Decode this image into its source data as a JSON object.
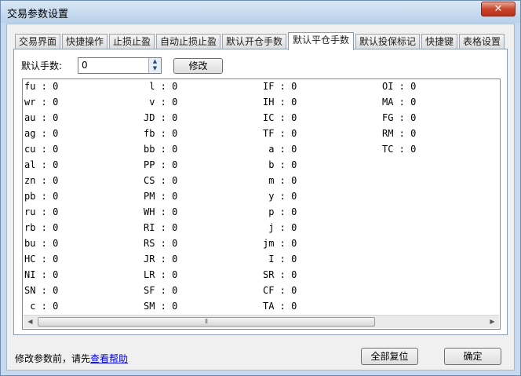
{
  "window": {
    "title": "交易参数设置",
    "close_glyph": "✕"
  },
  "tabs": [
    "交易界面",
    "快捷操作",
    "止损止盈",
    "自动止损止盈",
    "默认开仓手数",
    "默认平仓手数",
    "默认投保标记",
    "快捷键",
    "表格设置"
  ],
  "active_tab": "默认平仓手数",
  "form": {
    "label": "默认手数:",
    "value": "0",
    "modify_button": "修改"
  },
  "columns": [
    [
      "fu : 0",
      "wr : 0",
      "au : 0",
      "ag : 0",
      "cu : 0",
      "al : 0",
      "zn : 0",
      "pb : 0",
      "ru : 0",
      "rb : 0",
      "bu : 0",
      "HC : 0",
      "NI : 0",
      "SN : 0",
      " c : 0"
    ],
    [
      " l : 0",
      " v : 0",
      "JD : 0",
      "fb : 0",
      "bb : 0",
      "PP : 0",
      "CS : 0",
      "PM : 0",
      "WH : 0",
      "RI : 0",
      "RS : 0",
      "JR : 0",
      "LR : 0",
      "SF : 0",
      "SM : 0"
    ],
    [
      "IF : 0",
      "IH : 0",
      "IC : 0",
      "TF : 0",
      " a : 0",
      " b : 0",
      " m : 0",
      " y : 0",
      " p : 0",
      " j : 0",
      "jm : 0",
      " I : 0",
      "SR : 0",
      "CF : 0",
      "TA : 0"
    ],
    [
      "OI : 0",
      "MA : 0",
      "FG : 0",
      "RM : 0",
      "TC : 0"
    ]
  ],
  "scrollbar": {
    "left_arrow": "◀",
    "right_arrow": "▶",
    "grip": "⦀"
  },
  "footer": {
    "text": "修改参数前，请先",
    "link": "查看帮助",
    "reset_button": "全部复位",
    "ok_button": "确定"
  }
}
